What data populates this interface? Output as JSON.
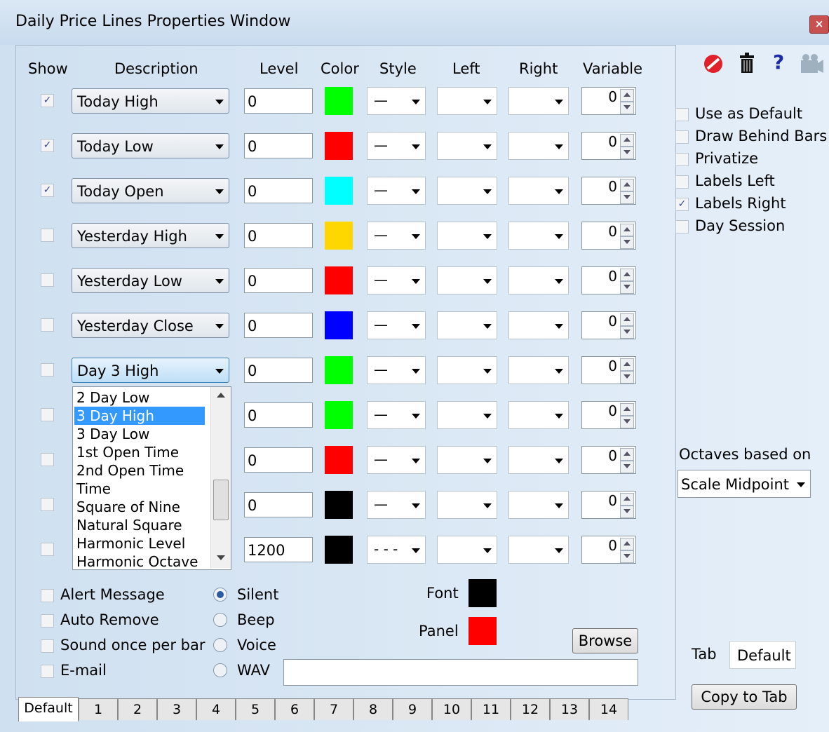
{
  "window": {
    "title": "Daily Price Lines Properties Window"
  },
  "headers": {
    "show": "Show",
    "description": "Description",
    "level": "Level",
    "color": "Color",
    "style": "Style",
    "left": "Left",
    "right": "Right",
    "variable": "Variable"
  },
  "rows": [
    {
      "checked": true,
      "description": "Today High",
      "level": "0",
      "color": "#00ff00",
      "style": "—",
      "variable": "0"
    },
    {
      "checked": true,
      "description": "Today Low",
      "level": "0",
      "color": "#ff0000",
      "style": "—",
      "variable": "0"
    },
    {
      "checked": true,
      "description": "Today Open",
      "level": "0",
      "color": "#00ffff",
      "style": "—",
      "variable": "0"
    },
    {
      "checked": false,
      "description": "Yesterday High",
      "level": "0",
      "color": "#ffd700",
      "style": "—",
      "variable": "0"
    },
    {
      "checked": false,
      "description": "Yesterday Low",
      "level": "0",
      "color": "#ff0000",
      "style": "—",
      "variable": "0"
    },
    {
      "checked": false,
      "description": "Yesterday Close",
      "level": "0",
      "color": "#0000ff",
      "style": "—",
      "variable": "0"
    },
    {
      "checked": false,
      "description": "Day 3 High",
      "level": "0",
      "color": "#00ff00",
      "style": "—",
      "variable": "0"
    },
    {
      "checked": false,
      "description": "",
      "level": "0",
      "color": "#00ff00",
      "style": "—",
      "variable": "0"
    },
    {
      "checked": false,
      "description": "",
      "level": "0",
      "color": "#ff0000",
      "style": "—",
      "variable": "0"
    },
    {
      "checked": false,
      "description": "",
      "level": "0",
      "color": "#000000",
      "style": "—",
      "variable": "0"
    },
    {
      "checked": false,
      "description": "",
      "level": "1200",
      "color": "#000000",
      "style": "- - -",
      "variable": "0"
    }
  ],
  "dropdown_list": {
    "items": [
      "2 Day Low",
      "3 Day High",
      "3 Day Low",
      " 1st Open Time",
      "2nd Open Time",
      "Time",
      "Square of Nine",
      "Natural Square",
      "Harmonic Level",
      "Harmonic Octave"
    ],
    "selected": "3 Day High"
  },
  "alerts": {
    "alert_message": "Alert Message",
    "auto_remove": "Auto Remove",
    "sound_once": "Sound once per bar",
    "email": "E-mail",
    "silent": "Silent",
    "beep": "Beep",
    "voice": "Voice",
    "wav": "WAV",
    "selected_sound": "Silent",
    "font_label": "Font",
    "panel_label": "Panel",
    "font_color": "#000000",
    "panel_color": "#ff0000",
    "browse": "Browse",
    "wav_path": ""
  },
  "options": {
    "use_as_default": "Use as Default",
    "draw_behind_bars": "Draw Behind Bars",
    "privatize": "Privatize",
    "labels_left": "Labels Left",
    "labels_right": "Labels Right",
    "labels_right_checked": true,
    "day_session": "Day Session",
    "octaves_label": "Octaves based on",
    "octaves_value": "Scale Midpoint",
    "tab_label": "Tab",
    "tab_value": "Default",
    "copy_to_tab": "Copy to Tab"
  },
  "tabs": [
    "Default",
    "1",
    "2",
    "3",
    "4",
    "5",
    "6",
    "7",
    "8",
    "9",
    "10",
    "11",
    "12",
    "13",
    "14"
  ],
  "active_tab": "Default",
  "toolbar_icons": [
    "no-entry-icon",
    "trash-icon",
    "help-icon",
    "camera-icon"
  ]
}
